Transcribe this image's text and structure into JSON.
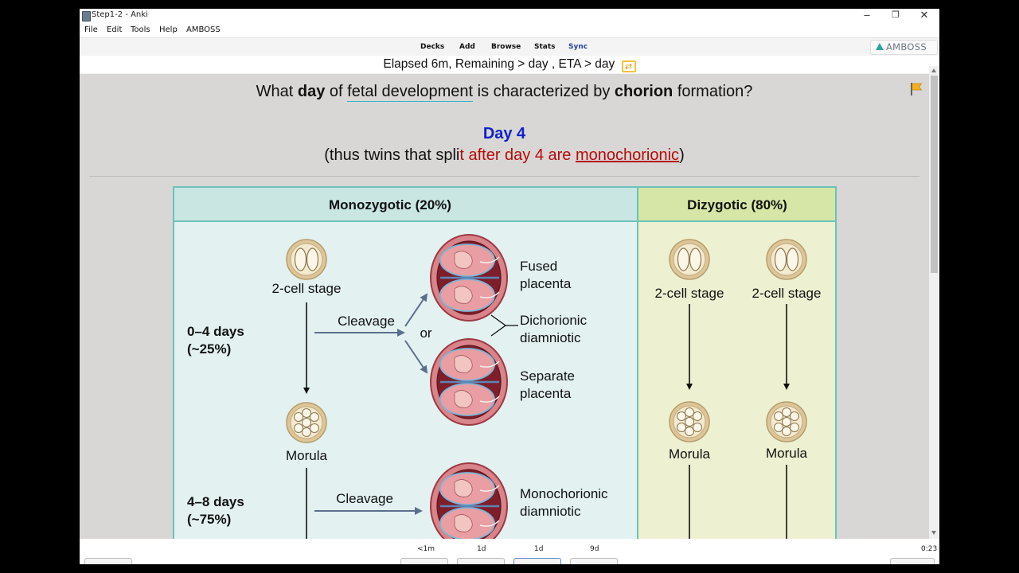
{
  "window": {
    "title": "Step1-2 - Anki",
    "controls": {
      "minimize": "–",
      "maximize": "❐",
      "close": "✕"
    }
  },
  "menu": [
    "File",
    "Edit",
    "Tools",
    "Help",
    "AMBOSS"
  ],
  "toolbar": {
    "items": [
      "Decks",
      "Add",
      "Browse",
      "Stats",
      "Sync"
    ],
    "amboss_label": "AMBOSS",
    "sync_color": "#2a43a8",
    "amboss_accent": "#2aa3a0"
  },
  "status": {
    "text": "Elapsed 6m, Remaining > day , ETA > day",
    "icon": "return-arrow-icon"
  },
  "card": {
    "question": {
      "p1": "What ",
      "b1": "day",
      "p2": " of ",
      "link": "fetal development",
      "p3": " is characterized by ",
      "b2": "chorion",
      "p4": " formation?"
    },
    "answer_title": "Day 4",
    "answer": {
      "a1": "(thus twins that spli",
      "a2": "t after day 4 are ",
      "a3": "monochorionic",
      "a4": ")"
    },
    "flag_icon": "flag-icon",
    "answer_color": "#1221c9",
    "emphasis_color": "#b80a0a"
  },
  "figure": {
    "mono_header": "Monozygotic (20%)",
    "di_header": "Dizygotic (80%)",
    "two_cell": "2-cell stage",
    "morula": "Morula",
    "cleavage": "Cleavage",
    "or": "or",
    "days_0_4": "0–4 days",
    "pct_25": "(~25%)",
    "days_4_8": "4–8 days",
    "pct_75": "(~75%)",
    "fused_1": "Fused",
    "fused_2": "placenta",
    "dichor_1": "Dichorionic",
    "dichor_2": "diamniotic",
    "sep_1": "Separate",
    "sep_2": "placenta",
    "mono_1": "Monochorionic",
    "mono_2": "diamniotic",
    "colors": {
      "mono_bg": "#e3f1f1",
      "mono_header": "#c9e6e3",
      "di_bg": "#edf1d2",
      "di_header": "#d6e6a6",
      "border": "#6cc2b9"
    }
  },
  "answer_buttons": {
    "intervals": [
      "<1m",
      "1d",
      "1d",
      "9d"
    ],
    "timer": "0:23"
  }
}
